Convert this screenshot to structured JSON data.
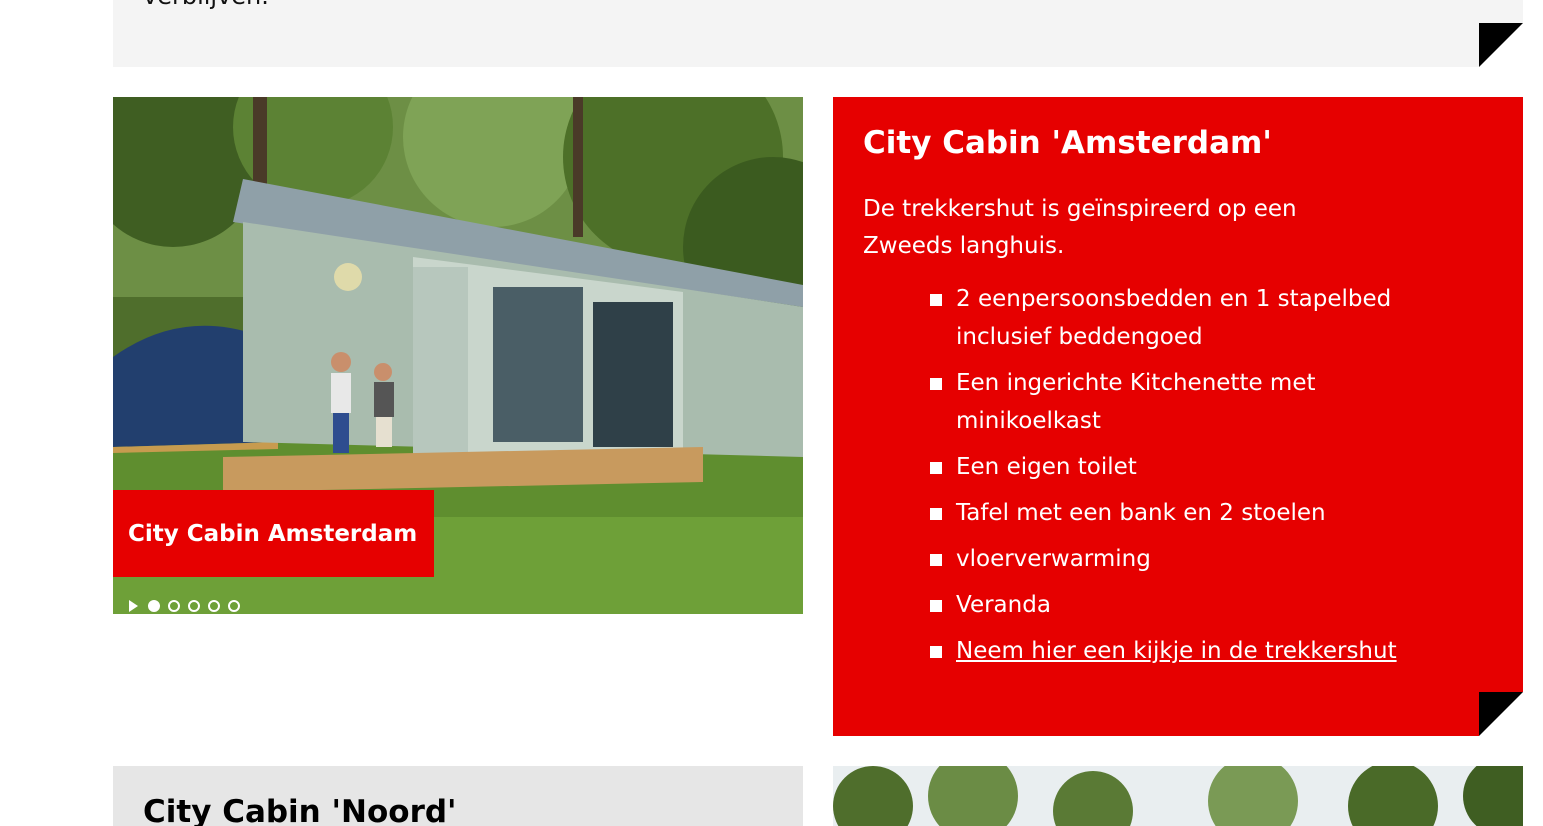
{
  "top_card": {
    "text": "verblijven."
  },
  "slider": {
    "caption": "City Cabin Amsterdam",
    "dots": [
      true,
      false,
      false,
      false,
      false
    ]
  },
  "info": {
    "title": "City Cabin 'Amsterdam'",
    "intro": "De trekkershut is geïnspireerd op een Zweeds langhuis.",
    "features": [
      "2 eenpersoonsbedden en 1 stapelbed inclusief beddengoed",
      "Een ingerichte Kitchenette met minikoelkast",
      "Een eigen toilet",
      "Tafel met een bank en 2 stoelen",
      "vloerverwarming",
      "Veranda"
    ],
    "link": "Neem hier een kijkje in de trekkershut"
  },
  "next_card": {
    "title": "City Cabin 'Noord'"
  }
}
